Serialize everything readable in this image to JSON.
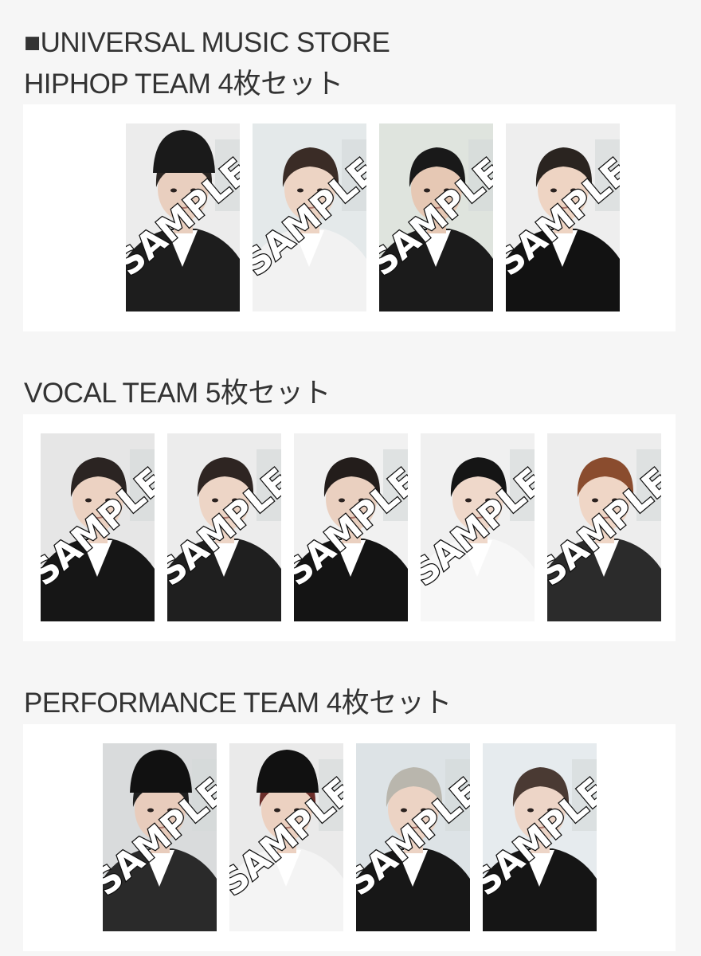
{
  "store_title": "■UNIVERSAL MUSIC STORE",
  "sections": [
    {
      "title": "HIPHOP TEAM 4枚セット",
      "cards": [
        {
          "watermark": "SAMPLE",
          "bg": "#ececec",
          "hair": "#2a2522",
          "hat": "#1a1a1a",
          "skin": "#e9cfbf",
          "outfit": "#1d1d1d",
          "shirt": "#ffffff"
        },
        {
          "watermark": "SAMPLE",
          "bg": "#e4e9ea",
          "hair": "#3a2c26",
          "hat": "",
          "skin": "#edd4c4",
          "outfit": "#f2f2f2",
          "shirt": "#ffffff"
        },
        {
          "watermark": "SAMPLE",
          "bg": "#dfe4de",
          "hair": "#191919",
          "hat": "",
          "skin": "#e6c8b4",
          "outfit": "#1b1b1b",
          "shirt": "#ffffff"
        },
        {
          "watermark": "SAMPLE",
          "bg": "#eeeeee",
          "hair": "#2a2420",
          "hat": "",
          "skin": "#eed4c3",
          "outfit": "#121212",
          "shirt": "#ffffff"
        }
      ]
    },
    {
      "title": "VOCAL TEAM 5枚セット",
      "cards": [
        {
          "watermark": "SAMPLE",
          "bg": "#e6e6e6",
          "hair": "#2b2422",
          "hat": "",
          "skin": "#ecd2c2",
          "outfit": "#161616",
          "shirt": "#ffffff"
        },
        {
          "watermark": "SAMPLE",
          "bg": "#ececec",
          "hair": "#2e2522",
          "hat": "",
          "skin": "#edd5c6",
          "outfit": "#1f1f1f",
          "shirt": "#ffffff"
        },
        {
          "watermark": "SAMPLE",
          "bg": "#f1f1f1",
          "hair": "#231d1b",
          "hat": "",
          "skin": "#ead0c0",
          "outfit": "#141414",
          "shirt": "#ffffff"
        },
        {
          "watermark": "SAMPLE",
          "bg": "#f0f0f0",
          "hair": "#151515",
          "hat": "",
          "skin": "#efd8ca",
          "outfit": "#f7f7f7",
          "shirt": "#ffffff"
        },
        {
          "watermark": "SAMPLE",
          "bg": "#ededed",
          "hair": "#8a4c2e",
          "hat": "",
          "skin": "#efd6c6",
          "outfit": "#2b2b2b",
          "shirt": "#ffffff"
        }
      ]
    },
    {
      "title": "PERFORMANCE TEAM 4枚セット",
      "cards": [
        {
          "watermark": "SAMPLE",
          "bg": "#d9dbdc",
          "hair": "#1e1e1e",
          "hat": "#111111",
          "skin": "#e8ccbc",
          "outfit": "#2a2a2a",
          "shirt": "#ffffff"
        },
        {
          "watermark": "SAMPLE",
          "bg": "#eaeaea",
          "hair": "#6b2e2a",
          "hat": "#111111",
          "skin": "#ecd1c1",
          "outfit": "#f4f4f4",
          "shirt": "#ffffff"
        },
        {
          "watermark": "SAMPLE",
          "bg": "#dde3e6",
          "hair": "#b9b6ad",
          "hat": "",
          "skin": "#ecd3c4",
          "outfit": "#171717",
          "shirt": "#ffffff"
        },
        {
          "watermark": "SAMPLE",
          "bg": "#e6ebee",
          "hair": "#4a3a33",
          "hat": "",
          "skin": "#edd5c7",
          "outfit": "#151515",
          "shirt": "#ffffff"
        }
      ]
    }
  ]
}
